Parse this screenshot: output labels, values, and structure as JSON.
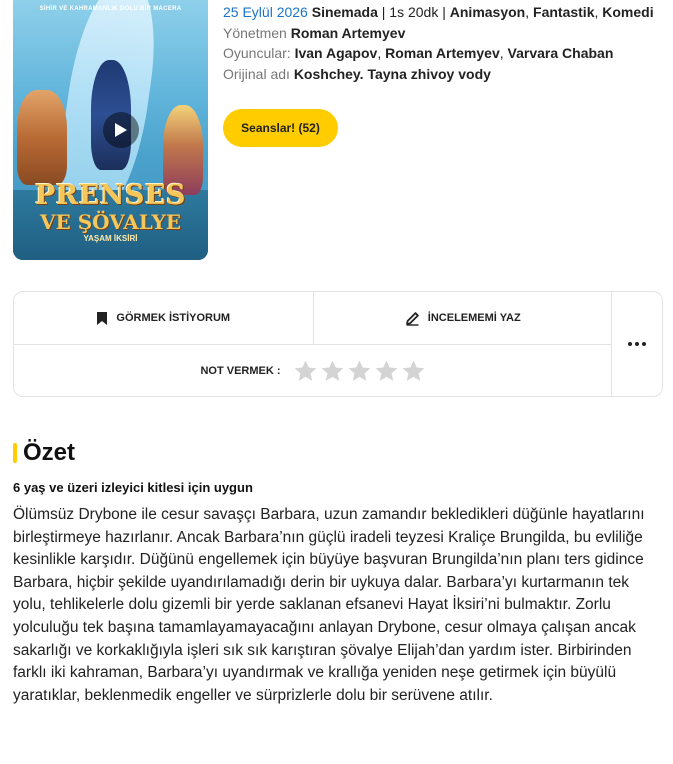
{
  "poster": {
    "tagline": "SİHİR VE KAHRAMANLIK DOLU BİR MACERA",
    "title_line1": "PRENSES",
    "title_line2": "VE ŞÖVALYE",
    "title_line3": "YAŞAM İKSİRİ"
  },
  "meta": {
    "release_date": "25 Eylül 2026",
    "release_status": "Sinemada",
    "separator": "|",
    "duration": "1s 20dk",
    "genres": [
      "Animasyon",
      "Fantastik",
      "Komedi"
    ],
    "director_label": "Yönetmen",
    "director": "Roman Artemyev",
    "cast_label": "Oyuncular:",
    "cast": [
      "Ivan Agapov",
      "Roman Artemyev",
      "Varvara Chaban"
    ],
    "original_title_label": "Orijinal adı",
    "original_title": "Koshchey. Tayna zhivoy vody"
  },
  "sessions_button": "Seanslar! (52)",
  "actions": {
    "want_to_see": "GÖRMEK İSTİYORUM",
    "write_review": "İNCELEMEMİ YAZ",
    "rate_label": "NOT VERMEK :",
    "star_count": 5,
    "rating": 0
  },
  "summary": {
    "heading": "Özet",
    "age_note": "6 yaş ve üzeri izleyici kitlesi için uygun",
    "text": "Ölümsüz Drybone ile cesur savaşçı Barbara, uzun zamandır bekledikleri düğünle hayatlarını birleştirmeye hazırlanır. Ancak Barbara’nın güçlü iradeli teyzesi Kraliçe Brungilda, bu evliliğe kesinlikle karşıdır. Düğünü engellemek için büyüye başvuran Brungilda’nın planı ters gidince Barbara, hiçbir şekilde uyandırılamadığı derin bir uykuya dalar. Barbara’yı kurtarmanın tek yolu, tehlikelerle dolu gizemli bir yerde saklanan efsanevi Hayat İksiri’ni bulmaktır. Zorlu yolculuğu tek başına tamamlayamayacağını anlayan Drybone, cesur olmaya çalışan ancak sakarlığı ve korkaklığıyla işleri sık sık karıştıran şövalye Elijah’dan yardım ister. Birbirinden farklı iki kahraman, Barbara’yı uyandırmak ve krallığa yeniden neşe getirmek için büyülü yaratıklar, beklenmedik engeller ve sürprizlerle dolu bir serüvene atılır."
  },
  "colors": {
    "accent": "#ffcc00",
    "link": "#1a73c8",
    "muted": "#777777",
    "star_empty": "#d4d4d4"
  },
  "icons": {
    "bookmark": "bookmark-icon",
    "pencil": "pencil-icon",
    "more": "more-dots-icon",
    "star": "star-icon",
    "play": "play-icon"
  }
}
